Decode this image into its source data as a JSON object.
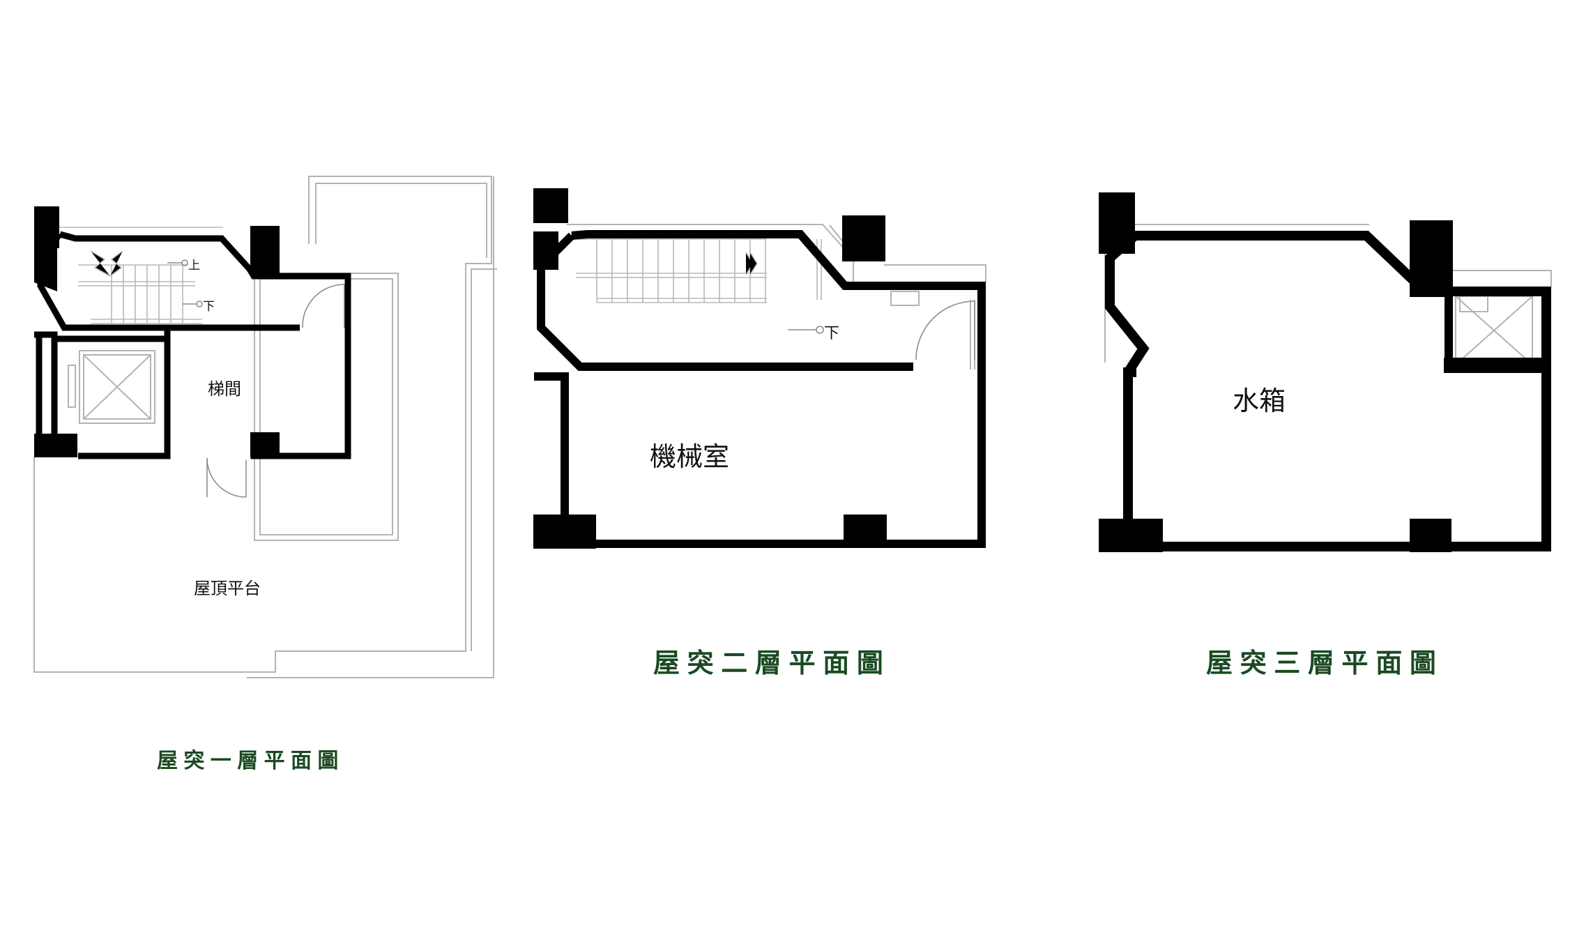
{
  "colors": {
    "title_green": "#1a4a22",
    "wall": "#000000",
    "fixture_line": "#b3b3b3"
  },
  "plans": [
    {
      "title": "屋突一層平面圖",
      "rooms": [
        "梯間",
        "屋頂平台"
      ],
      "marks": [
        "上",
        "下"
      ]
    },
    {
      "title": "屋突二層平面圖",
      "rooms": [
        "機械室"
      ],
      "marks": [
        "下"
      ]
    },
    {
      "title": "屋突三層平面圖",
      "rooms": [
        "水箱"
      ],
      "marks": []
    }
  ]
}
